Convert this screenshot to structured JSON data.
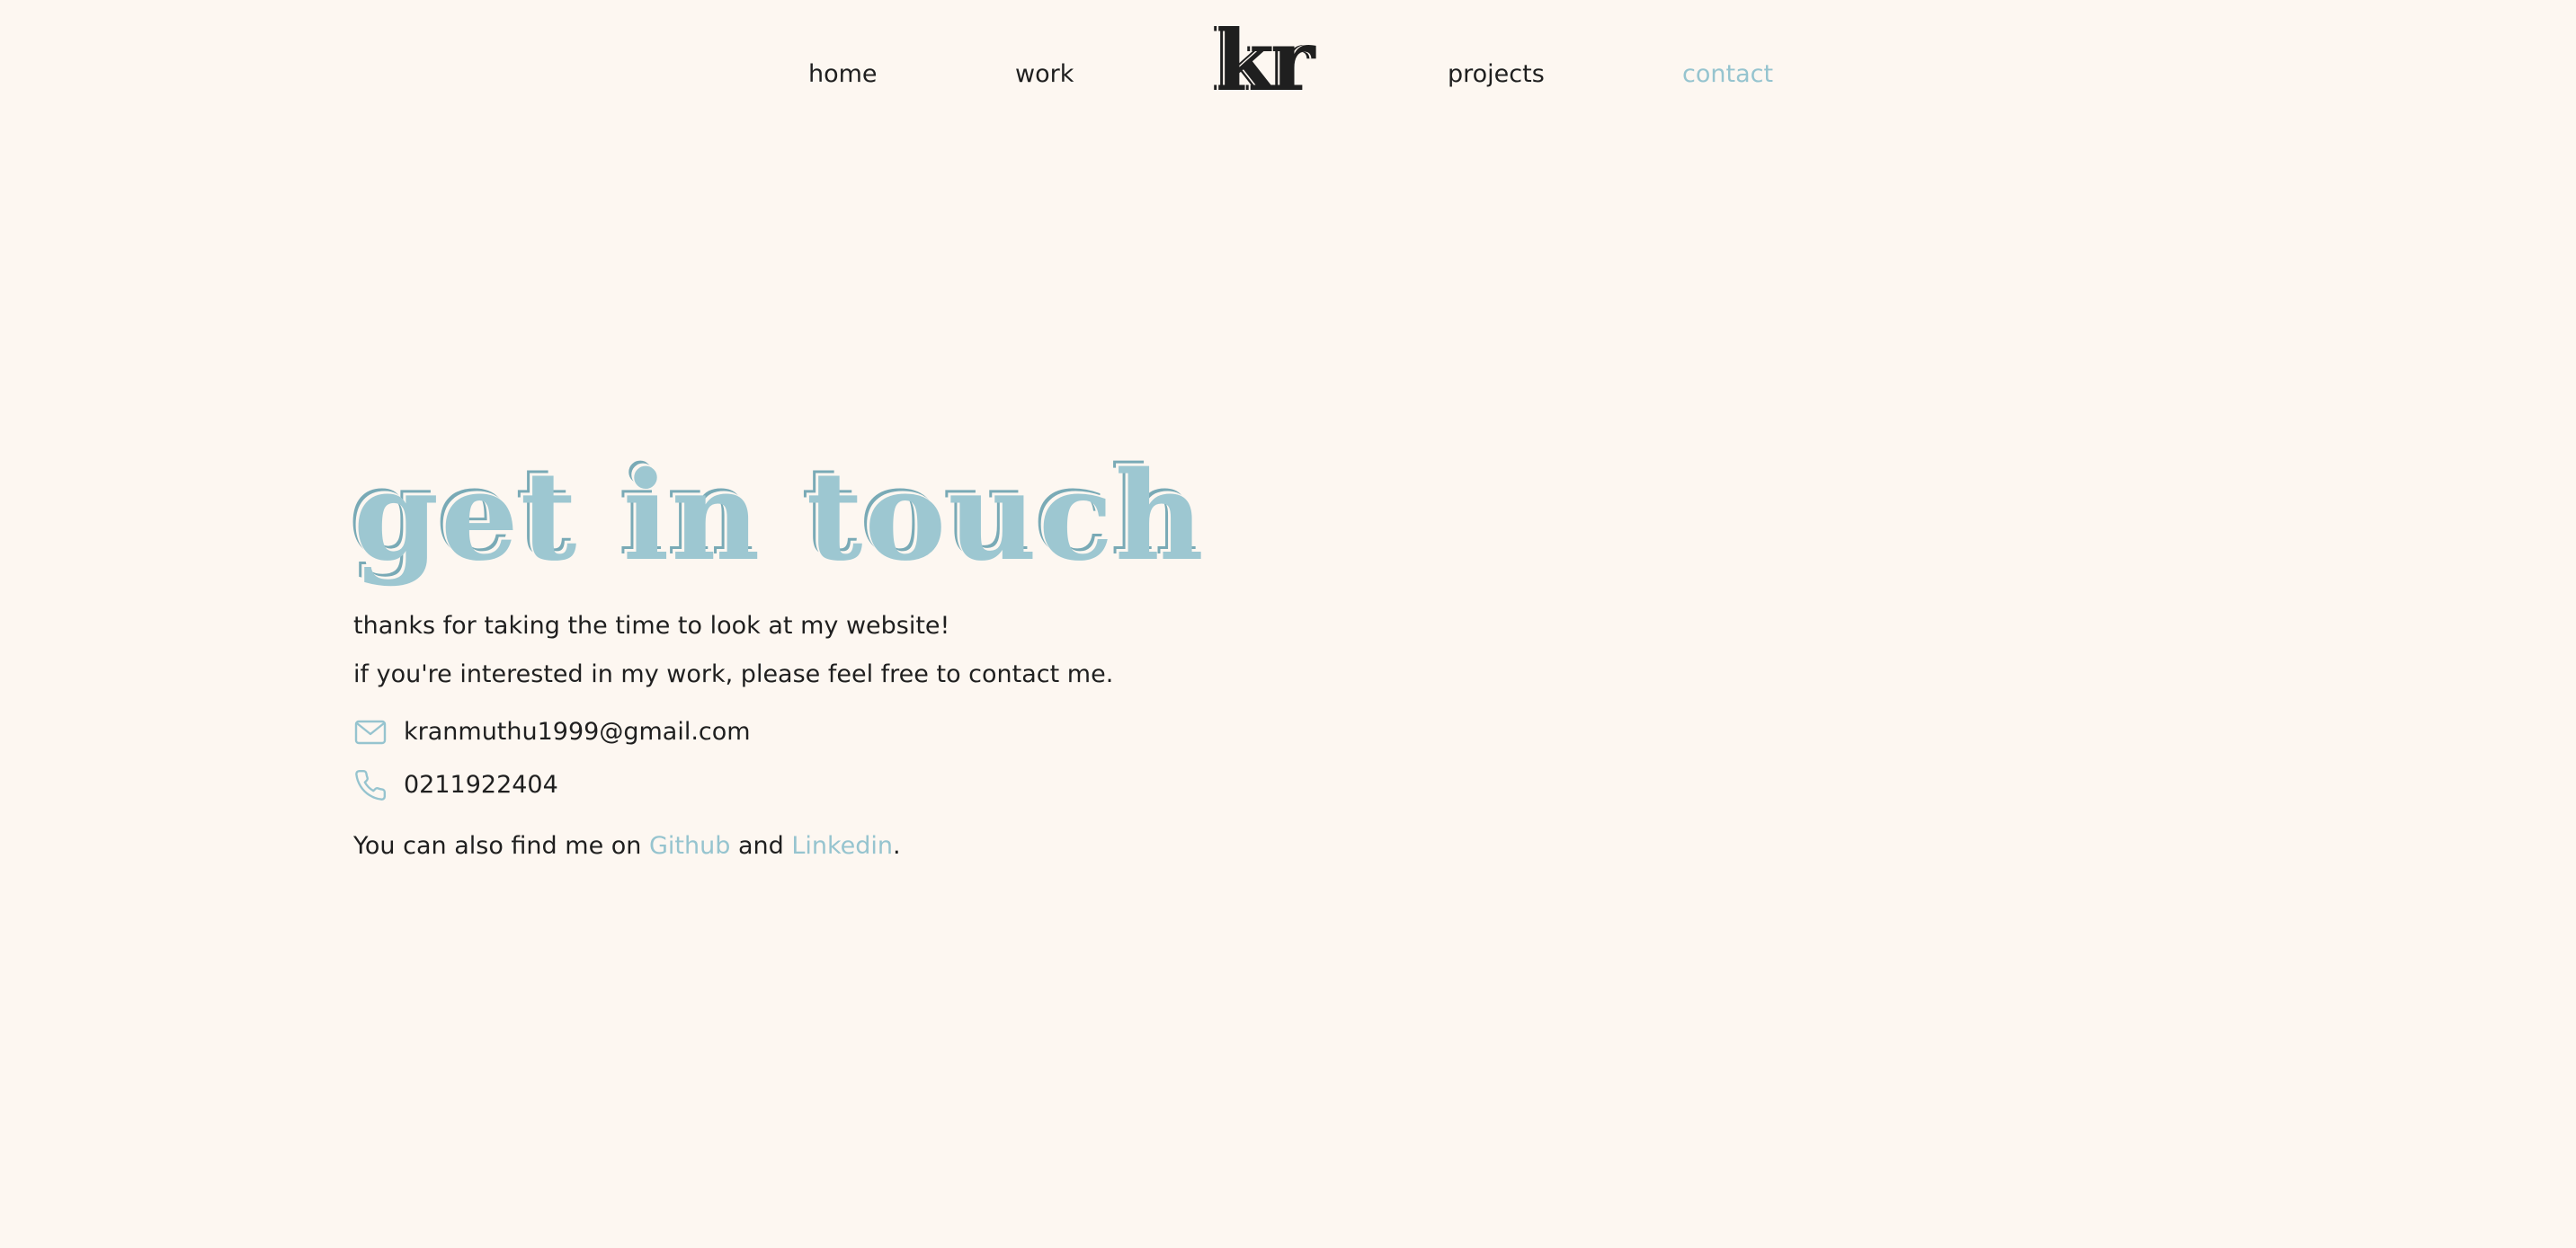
{
  "nav": {
    "home": "home",
    "work": "work",
    "logo": "kr",
    "projects": "projects",
    "contact": "contact",
    "active": "contact"
  },
  "colors": {
    "background": "#fdf7f1",
    "text": "#1f1f1f",
    "accent": "#96c4cf"
  },
  "hero": {
    "headline": "get in touch",
    "line1": "thanks for taking the time to look at my website!",
    "line2": "if you're interested in my work, please feel free to contact me."
  },
  "contact": {
    "email_icon": "envelope-icon",
    "email": "kranmuthu1999@gmail.com",
    "phone_icon": "phone-icon",
    "phone": "0211922404"
  },
  "social": {
    "prefix": "You can also find me on ",
    "github": "Github",
    "joiner": " and ",
    "linkedin": "Linkedin",
    "suffix": "."
  }
}
